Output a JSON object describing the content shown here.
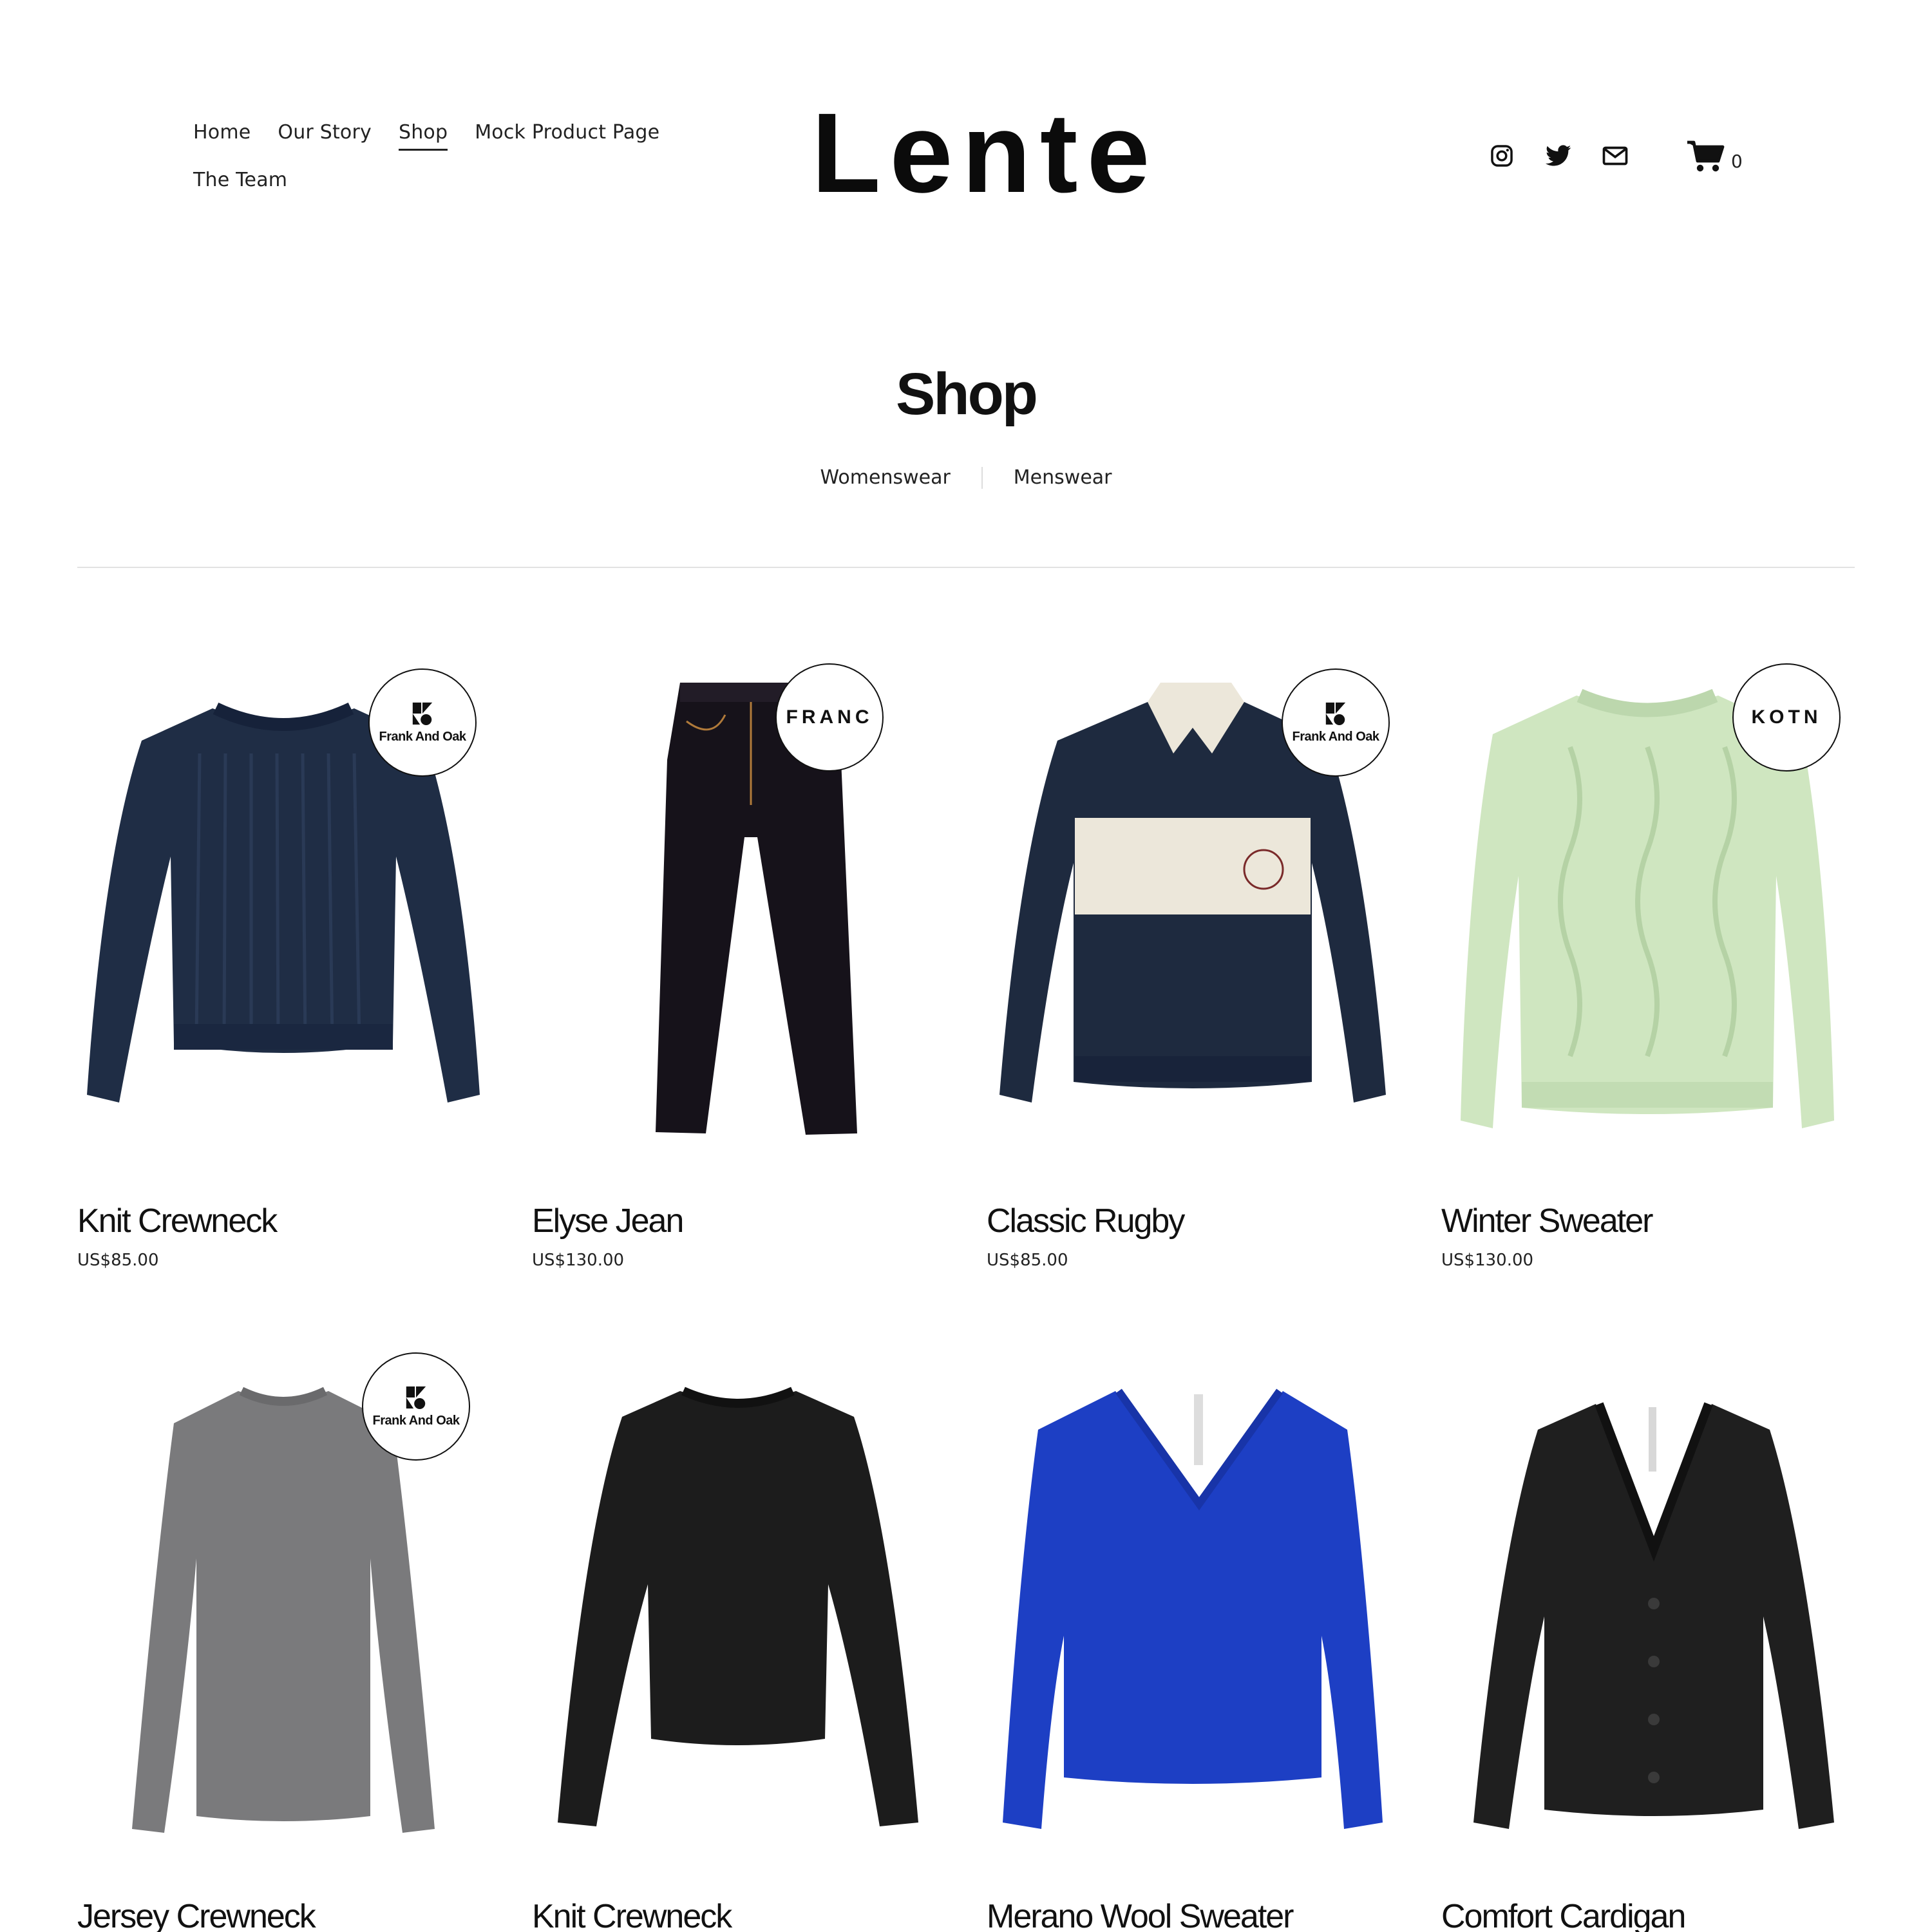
{
  "nav": {
    "items": [
      {
        "label": "Home",
        "active": false
      },
      {
        "label": "Our Story",
        "active": false
      },
      {
        "label": "Shop",
        "active": true
      },
      {
        "label": "Mock Product Page",
        "active": false
      },
      {
        "label": "The Team",
        "active": false
      }
    ]
  },
  "brand": {
    "logo_text": "Lente"
  },
  "social": {
    "icons": [
      "instagram-icon",
      "twitter-icon",
      "email-icon"
    ]
  },
  "cart": {
    "icon": "cart-icon",
    "count": "0"
  },
  "page": {
    "title": "Shop"
  },
  "categories": [
    "Womenswear",
    "Menswear"
  ],
  "products": [
    {
      "name": "Knit Crewneck",
      "price": "US$85.00",
      "badge": "Frank And Oak",
      "color": "#1f2d45"
    },
    {
      "name": "Elyse Jean",
      "price": "US$130.00",
      "badge": "FRANC",
      "color": "#16121a"
    },
    {
      "name": "Classic Rugby",
      "price": "US$85.00",
      "badge": "Frank And Oak",
      "color": "#1e2a3f"
    },
    {
      "name": "Winter Sweater",
      "price": "US$130.00",
      "badge": "KOTN",
      "color": "#cfe6c0"
    },
    {
      "name": "Jersey Crewneck",
      "price": "",
      "badge": "Frank And Oak",
      "color": "#7a7a7c"
    },
    {
      "name": "Knit Crewneck",
      "price": "",
      "badge": "",
      "color": "#1c1c1c"
    },
    {
      "name": "Merano Wool Sweater",
      "price": "",
      "badge": "",
      "color": "#1d3fc4"
    },
    {
      "name": "Comfort Cardigan",
      "price": "",
      "badge": "",
      "color": "#1f1f1f"
    }
  ]
}
